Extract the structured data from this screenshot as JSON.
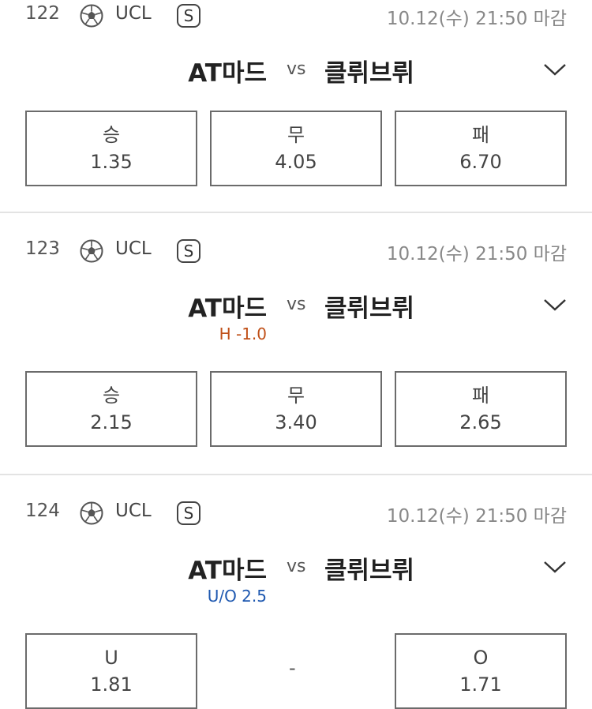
{
  "matches": [
    {
      "number": "122",
      "league": "UCL",
      "badge": "S",
      "deadline": "10.12(수) 21:50 마감",
      "home": "AT마드",
      "vs": "vs",
      "away": "클뤼브뤼",
      "odds": [
        {
          "label": "승",
          "value": "1.35"
        },
        {
          "label": "무",
          "value": "4.05"
        },
        {
          "label": "패",
          "value": "6.70"
        }
      ]
    },
    {
      "number": "123",
      "league": "UCL",
      "badge": "S",
      "deadline": "10.12(수) 21:50 마감",
      "home": "AT마드",
      "vs": "vs",
      "away": "클뤼브뤼",
      "handicap": "H -1.0",
      "odds": [
        {
          "label": "승",
          "value": "2.15"
        },
        {
          "label": "무",
          "value": "3.40"
        },
        {
          "label": "패",
          "value": "2.65"
        }
      ]
    },
    {
      "number": "124",
      "league": "UCL",
      "badge": "S",
      "deadline": "10.12(수) 21:50 마감",
      "home": "AT마드",
      "vs": "vs",
      "away": "클뤼브뤼",
      "handicap": "U/O 2.5",
      "odds": [
        {
          "label": "U",
          "value": "1.81"
        },
        {
          "label": "-",
          "value": ""
        },
        {
          "label": "O",
          "value": "1.71"
        }
      ]
    }
  ],
  "icons": {
    "sport": "soccer-ball-icon",
    "expand": "chevron-down-icon"
  },
  "colors": {
    "handicap": "#c05018",
    "under_over": "#1e58b0",
    "divider": "#e3e3e3"
  }
}
